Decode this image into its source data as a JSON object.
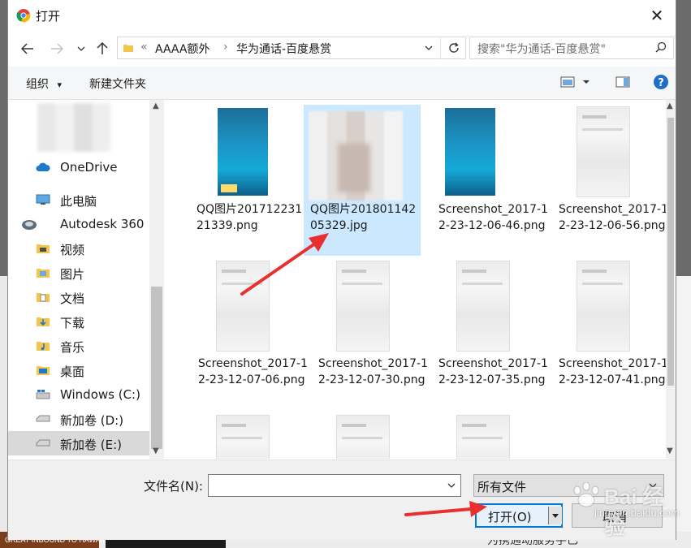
{
  "window": {
    "title": "打开",
    "close_glyph": "✕"
  },
  "address": {
    "overflow": "«",
    "crumbs": [
      "AAAA额外",
      "华为通话-百度悬赏"
    ],
    "separator": "›"
  },
  "search": {
    "placeholder": "搜索\"华为通话-百度悬赏\""
  },
  "toolbar": {
    "organize": "组织",
    "organize_caret": "▾",
    "new_folder": "新建文件夹",
    "help": "?"
  },
  "sidebar": {
    "items": [
      {
        "label": "OneDrive",
        "icon": "cloud-icon"
      },
      {
        "label": "此电脑",
        "icon": "computer-icon"
      },
      {
        "label": "Autodesk 360",
        "icon": "autodesk-icon"
      },
      {
        "label": "视频",
        "icon": "video-folder-icon"
      },
      {
        "label": "图片",
        "icon": "pictures-folder-icon"
      },
      {
        "label": "文档",
        "icon": "documents-folder-icon"
      },
      {
        "label": "下载",
        "icon": "downloads-folder-icon"
      },
      {
        "label": "音乐",
        "icon": "music-folder-icon"
      },
      {
        "label": "桌面",
        "icon": "desktop-folder-icon"
      },
      {
        "label": "Windows (C:)",
        "icon": "windows-drive-icon"
      },
      {
        "label": "新加卷 (D:)",
        "icon": "drive-icon"
      },
      {
        "label": "新加卷 (E:)",
        "icon": "drive-icon"
      }
    ]
  },
  "files": [
    {
      "name": "QQ图片20171223121339.png",
      "thumb": "blue"
    },
    {
      "name": "QQ图片20180114205329.jpg",
      "thumb": "qq2"
    },
    {
      "name": "Screenshot_2017-12-23-12-06-46.png",
      "thumb": "blue"
    },
    {
      "name": "Screenshot_2017-12-23-12-06-56.png",
      "thumb": "gray"
    },
    {
      "name": "Screenshot_2017-12-23-12-07-06.png",
      "thumb": "gray"
    },
    {
      "name": "Screenshot_2017-12-23-12-07-30.png",
      "thumb": "gray"
    },
    {
      "name": "Screenshot_2017-12-23-12-07-35.png",
      "thumb": "gray"
    },
    {
      "name": "Screenshot_2017-12-23-12-07-41.png",
      "thumb": "gray"
    },
    {
      "name": "",
      "thumb": "gray"
    },
    {
      "name": "",
      "thumb": "gray"
    },
    {
      "name": "",
      "thumb": "gray"
    }
  ],
  "bottom": {
    "filename_label": "文件名(N):",
    "filename_value": "",
    "filetype": "所有文件",
    "open_label": "打开(O)",
    "cancel_label": "取消"
  },
  "background": {
    "hawaii_text": "GREAT INBOUND TO HAWAII",
    "bottom_text": "为携通动服务手已"
  },
  "watermark": {
    "brand": "Bai  经验",
    "url": "jingyan.baidu.com"
  },
  "colors": {
    "accent": "#0078d7",
    "selection": "#cce8ff",
    "arrow": "#e8312f"
  }
}
